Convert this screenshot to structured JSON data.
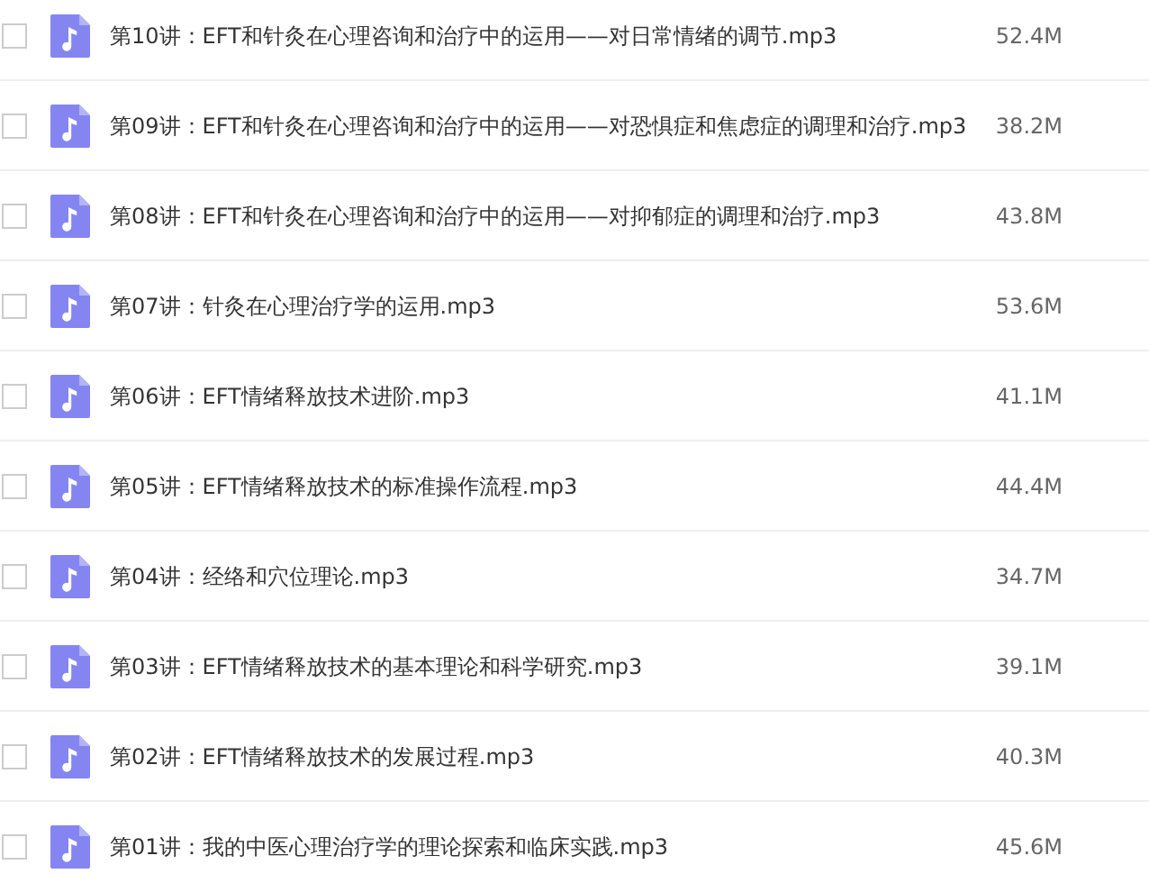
{
  "files": [
    {
      "name": "第10讲：EFT和针灸在心理咨询和治疗中的运用——对日常情绪的调节.mp3",
      "size": "52.4M",
      "checked": false
    },
    {
      "name": "第09讲：EFT和针灸在心理咨询和治疗中的运用——对恐惧症和焦虑症的调理和治疗.mp3",
      "size": "38.2M",
      "checked": false
    },
    {
      "name": "第08讲：EFT和针灸在心理咨询和治疗中的运用——对抑郁症的调理和治疗.mp3",
      "size": "43.8M",
      "checked": false
    },
    {
      "name": "第07讲：针灸在心理治疗学的运用.mp3",
      "size": "53.6M",
      "checked": false
    },
    {
      "name": "第06讲：EFT情绪释放技术进阶.mp3",
      "size": "41.1M",
      "checked": false
    },
    {
      "name": "第05讲：EFT情绪释放技术的标准操作流程.mp3",
      "size": "44.4M",
      "checked": false
    },
    {
      "name": "第04讲：经络和穴位理论.mp3",
      "size": "34.7M",
      "checked": false
    },
    {
      "name": "第03讲：EFT情绪释放技术的基本理论和科学研究.mp3",
      "size": "39.1M",
      "checked": false
    },
    {
      "name": "第02讲：EFT情绪释放技术的发展过程.mp3",
      "size": "40.3M",
      "checked": false
    },
    {
      "name": "第01讲：我的中医心理治疗学的理论探索和临床实践.mp3",
      "size": "45.6M",
      "checked": false
    }
  ]
}
